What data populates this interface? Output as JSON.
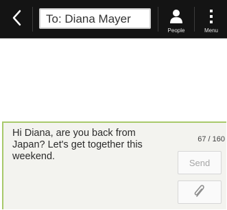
{
  "header": {
    "to_value": "To: Diana Mayer",
    "people_label": "People",
    "menu_label": "Menu",
    "back_icon": "chevron-left-icon",
    "people_icon": "person-icon",
    "menu_icon": "vertical-dots-icon"
  },
  "compose": {
    "message": "Hi Diana, are you back from Japan? Let's get together this weekend.",
    "counter": "67 / 160",
    "send_label": "Send",
    "attach_icon": "paperclip-icon",
    "accent_color": "#a7c96a"
  }
}
